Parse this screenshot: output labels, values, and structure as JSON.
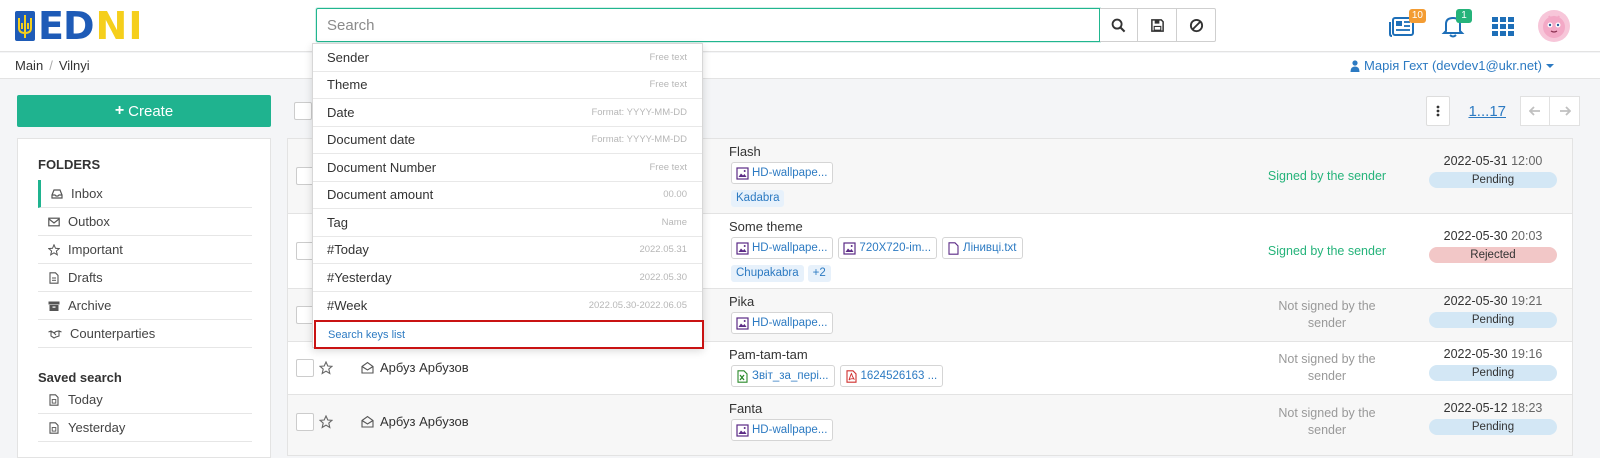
{
  "app": {
    "logo_text_1": "ED",
    "logo_text_2": "N",
    "logo_text_3": "I"
  },
  "search": {
    "placeholder": "Search",
    "value": ""
  },
  "header": {
    "badge_docs": "10",
    "badge_notifications": "1"
  },
  "breadcrumb": [
    "Main",
    "Vilnyi"
  ],
  "user": {
    "name": "Марія Гехт (devdev1@ukr.net)"
  },
  "sidebar": {
    "create_label": "Create",
    "folders_title": "FOLDERS",
    "folders": [
      {
        "label": "Inbox",
        "icon": "inbox-icon"
      },
      {
        "label": "Outbox",
        "icon": "envelope-icon"
      },
      {
        "label": "Important",
        "icon": "star-icon"
      },
      {
        "label": "Drafts",
        "icon": "file-icon"
      },
      {
        "label": "Archive",
        "icon": "archive-icon"
      },
      {
        "label": "Counterparties",
        "icon": "handshake-icon"
      }
    ],
    "saved_title": "Saved search",
    "saved": [
      {
        "label": "Today"
      },
      {
        "label": "Yesterday"
      }
    ]
  },
  "pager": {
    "range": "1...17"
  },
  "search_keys": [
    {
      "key": "Sender",
      "hint": "Free text"
    },
    {
      "key": "Theme",
      "hint": "Free text"
    },
    {
      "key": "Date",
      "hint": "Format: YYYY-MM-DD"
    },
    {
      "key": "Document date",
      "hint": "Format: YYYY-MM-DD"
    },
    {
      "key": "Document Number",
      "hint": "Free text"
    },
    {
      "key": "Document amount",
      "hint": "00.00"
    },
    {
      "key": "Tag",
      "hint": "Name"
    },
    {
      "key": "#Today",
      "hint": "2022.05.31"
    },
    {
      "key": "#Yesterday",
      "hint": "2022.05.30"
    },
    {
      "key": "#Week",
      "hint": "2022.05.30-2022.06.05"
    }
  ],
  "search_keys_link": "Search keys list",
  "documents": [
    {
      "sender": "",
      "subject": "Flash",
      "attachments": [
        {
          "name": "HD-wallpape...",
          "type": "image"
        }
      ],
      "tags": [
        "Kadabra"
      ],
      "signature": "Signed by the sender",
      "date": "2022-05-31",
      "time": "12:00",
      "status": "Pending"
    },
    {
      "sender": "",
      "subject": "Some theme",
      "attachments": [
        {
          "name": "HD-wallpape...",
          "type": "image"
        },
        {
          "name": "720X720-im...",
          "type": "image"
        },
        {
          "name": "Лінивці.txt",
          "type": "text"
        }
      ],
      "tags": [
        "Chupakabra",
        "+2"
      ],
      "signature": "Signed by the sender",
      "date": "2022-05-30",
      "time": "20:03",
      "status": "Rejected"
    },
    {
      "sender": "",
      "subject": "Pika",
      "attachments": [
        {
          "name": "HD-wallpape...",
          "type": "image"
        }
      ],
      "tags": [],
      "signature": "Not signed by the sender",
      "date": "2022-05-30",
      "time": "19:21",
      "status": "Pending"
    },
    {
      "sender": "Арбуз Арбузов",
      "subject": "Pam-tam-tam",
      "attachments": [
        {
          "name": "Звіт_за_пері...",
          "type": "excel"
        },
        {
          "name": "1624526163 ...",
          "type": "pdf"
        }
      ],
      "tags": [],
      "signature": "Not signed by the sender",
      "date": "2022-05-30",
      "time": "19:16",
      "status": "Pending"
    },
    {
      "sender": "Арбуз Арбузов",
      "subject": "Fanta",
      "attachments": [
        {
          "name": "HD-wallpape...",
          "type": "image"
        }
      ],
      "tags": [],
      "signature": "Not signed by the sender",
      "date": "2022-05-12",
      "time": "18:23",
      "status": "Pending"
    }
  ],
  "colors": {
    "accent": "#1fb38f",
    "link": "#2c7ac2",
    "logo_blue": "#1e5bb7",
    "logo_yellow": "#f5cf1c",
    "highlight_border": "#c91313"
  }
}
